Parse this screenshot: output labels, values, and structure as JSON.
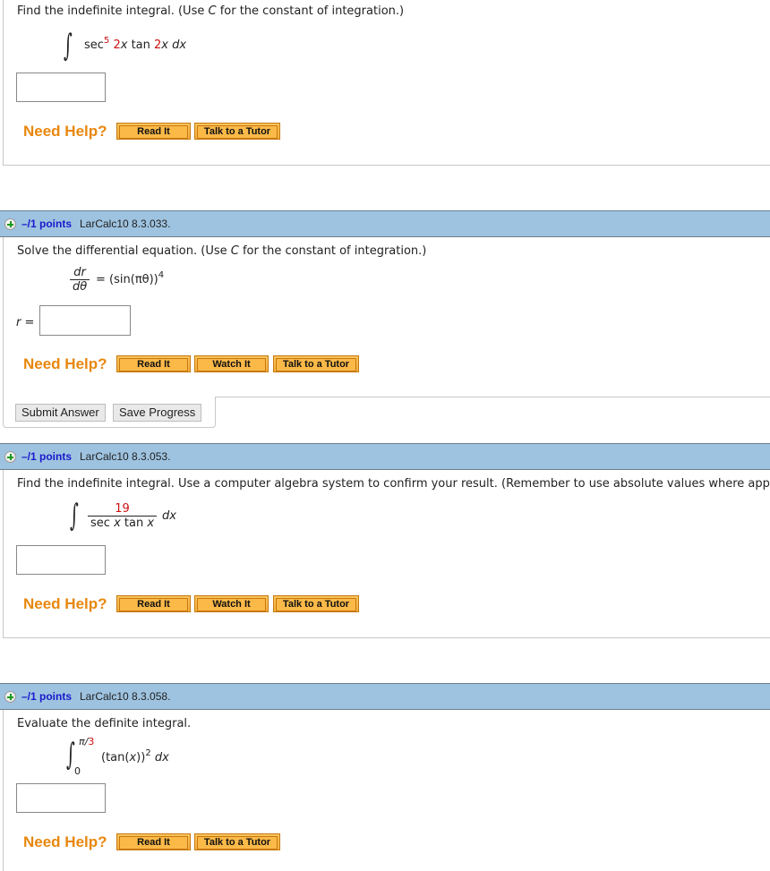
{
  "problems": [
    {
      "prompt": "Find the indefinite integral. (Use C for the constant of integration.)",
      "prompt_parts": [
        "Find the indefinite integral. (Use ",
        "C",
        " for the constant of integration.)"
      ],
      "expression": {
        "integral_symbol": "∫",
        "parts": [
          "sec",
          "5",
          "2",
          "x",
          "tan",
          "2",
          "x",
          "dx"
        ]
      },
      "answer_value": "",
      "need_help_label": "Need Help?",
      "help_buttons": [
        "Read It",
        "Talk to a Tutor"
      ]
    },
    {
      "header": {
        "points": "–/1 points",
        "reference": "LarCalc10 8.3.033."
      },
      "prompt_parts": [
        "Solve the differential equation. (Use ",
        "C",
        " for the constant of integration.)"
      ],
      "expression": {
        "numerator": "dr",
        "denominator": "dθ",
        "equals": "=",
        "rhs": "(sin(πθ))",
        "exponent": "4"
      },
      "answer_label": "r =",
      "answer_value": "",
      "need_help_label": "Need Help?",
      "help_buttons": [
        "Read It",
        "Watch It",
        "Talk to a Tutor"
      ],
      "submit_label": "Submit Answer",
      "save_label": "Save Progress"
    },
    {
      "header": {
        "points": "–/1 points",
        "reference": "LarCalc10 8.3.053."
      },
      "prompt": "Find the indefinite integral. Use a computer algebra system to confirm your result. (Remember to use absolute values where app",
      "expression": {
        "integral_symbol": "∫",
        "numerator": "19",
        "denominator_parts": [
          "sec ",
          "x",
          " tan ",
          "x"
        ],
        "dx": "dx"
      },
      "answer_value": "",
      "need_help_label": "Need Help?",
      "help_buttons": [
        "Read It",
        "Watch It",
        "Talk to a Tutor"
      ]
    },
    {
      "header": {
        "points": "–/1 points",
        "reference": "LarCalc10 8.3.058."
      },
      "prompt": "Evaluate the definite integral.",
      "expression": {
        "integral_symbol": "∫",
        "upper_pi": "π/",
        "upper_num": "3",
        "lower": "0",
        "integrand": "(tan(",
        "var": "x",
        "close": "))",
        "exponent": "2",
        "dx": "dx"
      },
      "answer_value": "",
      "need_help_label": "Need Help?",
      "help_buttons": [
        "Read It",
        "Talk to a Tutor"
      ]
    }
  ],
  "colors": {
    "header_bg": "#9ec3e0",
    "points_text": "#1a1acc",
    "need_help": "#e8870d",
    "help_button": "#f6b13e",
    "highlight_red": "#cc1111"
  }
}
